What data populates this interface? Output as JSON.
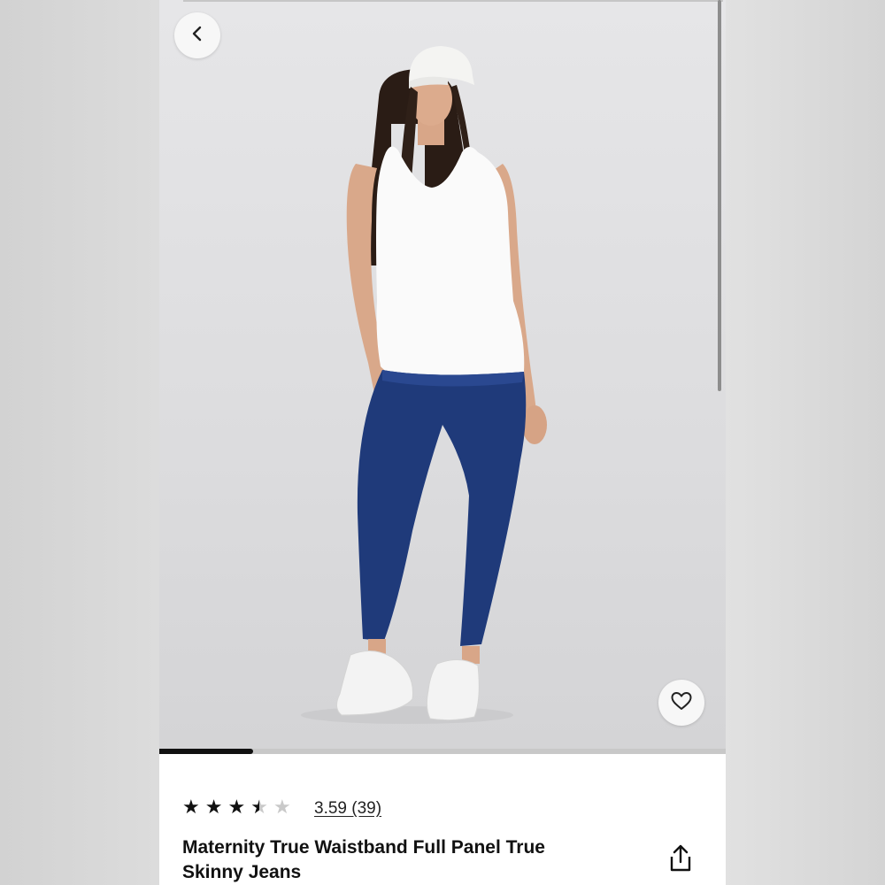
{
  "product": {
    "rating_text": "3.59 (39)",
    "rating_value": 3.59,
    "rating_max": 5,
    "review_count": 39,
    "title": "Maternity True Waistband Full Panel True Skinny Jeans"
  },
  "gallery": {
    "progress_fraction": 0.165,
    "image_alt": "Model wearing maternity skinny jeans with white tank top, white cap and white sneakers"
  },
  "icons": {
    "back": "chevron-left-icon",
    "favorite": "heart-icon",
    "share": "share-icon",
    "star": "star-icon"
  },
  "colors": {
    "text": "#111111",
    "denim": "#1f3a7a",
    "star_filled": "#111111",
    "star_empty": "#c9c9c9"
  }
}
